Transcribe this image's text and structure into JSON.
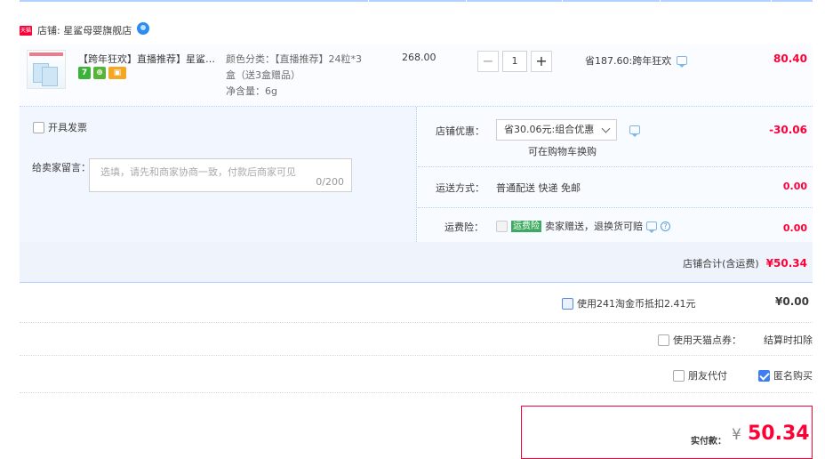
{
  "shop": {
    "badge": "天猫",
    "name": "店铺: 星鲨母婴旗舰店"
  },
  "item": {
    "title": "【跨年狂欢】直播推荐】星鲨婴...",
    "badges": [
      "7",
      "⊕",
      "▣"
    ],
    "sku_lines": [
      "颜色分类：【直播推荐】24粒*3",
      "盒（送3盒赠品）",
      "净含量：6g"
    ],
    "price": "268.00",
    "quantity": "1",
    "qty_minus": "−",
    "qty_plus": "+",
    "saving": "省187.60:跨年狂欢",
    "subtotal": "80.40"
  },
  "options": {
    "invoice_label": "开具发票",
    "message_label": "给卖家留言：",
    "message_placeholder": "选填，请先和商家协商一致，付款后商家可见",
    "message_count": "0/200",
    "shop_discount_label": "店铺优惠：",
    "shop_discount_value": "省30.06元:组合优惠",
    "shop_discount_note": "可在购物车换购",
    "shop_discount_amount": "-30.06",
    "delivery_label": "运送方式：",
    "delivery_value": "普通配送 快递 免邮",
    "delivery_amount": "0.00",
    "insurance_label": "运费险：",
    "insurance_tag": "运费险",
    "insurance_text": "卖家赠送，退换货可赔",
    "insurance_amount": "0.00"
  },
  "shop_total": {
    "label": "店铺合计(含运费)",
    "value": "¥50.34"
  },
  "coins": {
    "label": "使用241淘金币抵扣2.41元",
    "value": "¥0.00"
  },
  "points": {
    "label": "使用天猫点券：",
    "note": "结算时扣除"
  },
  "friend_pay": {
    "label": "朋友代付"
  },
  "anonymous": {
    "label": "匿名购买",
    "checked": true
  },
  "payment": {
    "label": "实付款：",
    "currency": "¥",
    "value": "50.34"
  },
  "colors": {
    "accent": "#ff0036",
    "border_blue": "#b2d1ff",
    "check_blue": "#3d7ef5"
  }
}
